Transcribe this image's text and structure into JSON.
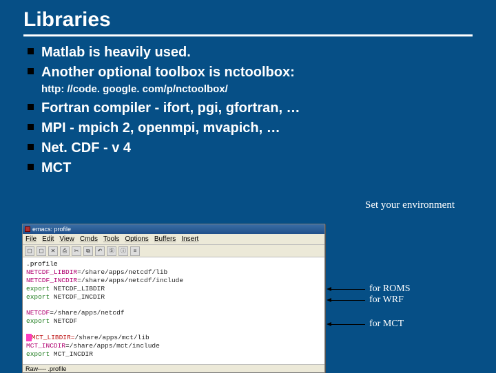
{
  "title": "Libraries",
  "bullets": {
    "b1": "Matlab is heavily used.",
    "b2": " Another optional toolbox is nctoolbox:",
    "b2_url": "http: //code. google. com/p/nctoolbox/",
    "b3": "Fortran compiler - ifort, pgi, gfortran, …",
    "b4": "MPI - mpich 2, openmpi, mvapich, …",
    "b5": "Net. CDF - v 4",
    "b6": "MCT"
  },
  "env_label": "Set your environment",
  "terminal": {
    "titlebar_text": "emacs: profile",
    "menu": [
      "File",
      "Edit",
      "View",
      "Cmds",
      "Tools",
      "Options",
      "Buffers",
      "Insert"
    ],
    "path_header": ".profile",
    "lines": [
      {
        "kw": "set",
        "var": "NETCDF_LIBDIR",
        "val": "=/share/apps/netcdf/lib"
      },
      {
        "kw": "set",
        "var": "NETCDF_INCDIR",
        "val": "=/share/apps/netcdf/include"
      },
      {
        "kw": "exp",
        "var": "export",
        "val": " NETCDF_LIBDIR"
      },
      {
        "kw": "exp",
        "var": "export",
        "val": " NETCDF_INCDIR"
      },
      {
        "blank": true
      },
      {
        "kw": "set",
        "var": "NETCDF",
        "val": "=/share/apps/netcdf"
      },
      {
        "kw": "exp",
        "var": "export",
        "val": " NETCDF"
      },
      {
        "blank": true
      },
      {
        "kw": "hash",
        "var": "MCT_LIBDIR=",
        "val": "/share/apps/mct/lib"
      },
      {
        "kw": "set",
        "var": "MCT_INCDIR",
        "val": "=/share/apps/mct/include"
      },
      {
        "kw": "exp",
        "var": "export",
        "val": " MCT_INCDIR"
      }
    ],
    "status": "Raw----  .profile"
  },
  "labels": {
    "roms": "for ROMS",
    "wrf": "for WRF",
    "mct": "for MCT"
  }
}
